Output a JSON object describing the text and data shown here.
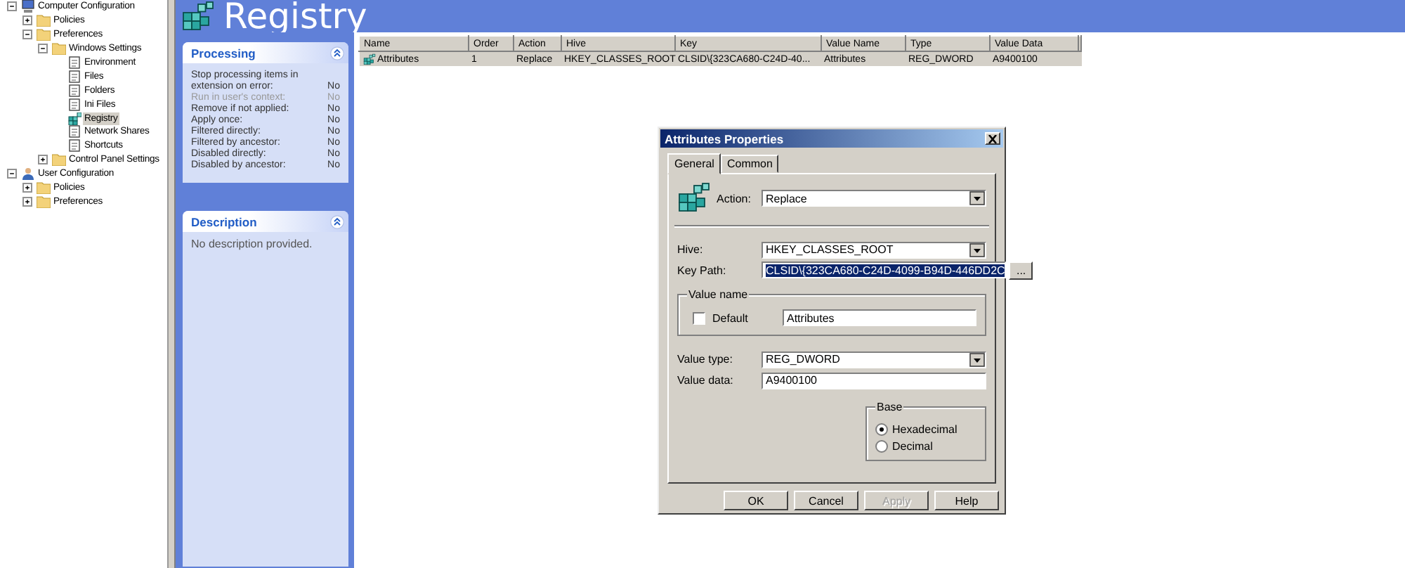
{
  "tree": [
    {
      "label": "Computer Configuration",
      "kind": "computer",
      "expanded": true,
      "selected": false,
      "children": [
        {
          "label": "Policies",
          "kind": "folder",
          "expanded": false,
          "selected": false
        },
        {
          "label": "Preferences",
          "kind": "folder",
          "expanded": true,
          "selected": false,
          "children": [
            {
              "label": "Windows Settings",
              "kind": "folder",
              "expanded": true,
              "selected": false,
              "children": [
                {
                  "label": "Environment",
                  "kind": "item",
                  "selected": false
                },
                {
                  "label": "Files",
                  "kind": "item",
                  "selected": false
                },
                {
                  "label": "Folders",
                  "kind": "item",
                  "selected": false
                },
                {
                  "label": "Ini Files",
                  "kind": "item",
                  "selected": false
                },
                {
                  "label": "Registry",
                  "kind": "registry",
                  "selected": true
                },
                {
                  "label": "Network Shares",
                  "kind": "item",
                  "selected": false
                },
                {
                  "label": "Shortcuts",
                  "kind": "item",
                  "selected": false
                }
              ]
            },
            {
              "label": "Control Panel Settings",
              "kind": "folder",
              "expanded": false,
              "selected": false
            }
          ]
        }
      ]
    },
    {
      "label": "User Configuration",
      "kind": "user",
      "expanded": true,
      "selected": false,
      "children": [
        {
          "label": "Policies",
          "kind": "folder",
          "expanded": false,
          "selected": false
        },
        {
          "label": "Preferences",
          "kind": "folder",
          "expanded": false,
          "selected": false
        }
      ]
    }
  ],
  "header": {
    "title": "Registry"
  },
  "processing": {
    "title": "Processing",
    "rows": [
      {
        "label": "Stop processing items in extension on error:",
        "value": "No",
        "disabled": false
      },
      {
        "label": "Run in user's context:",
        "value": "No",
        "disabled": true
      },
      {
        "label": "Remove if not applied:",
        "value": "No",
        "disabled": false
      },
      {
        "label": "Apply once:",
        "value": "No",
        "disabled": false
      },
      {
        "label": "Filtered directly:",
        "value": "No",
        "disabled": false
      },
      {
        "label": "Filtered by ancestor:",
        "value": "No",
        "disabled": false
      },
      {
        "label": "Disabled directly:",
        "value": "No",
        "disabled": false
      },
      {
        "label": "Disabled by ancestor:",
        "value": "No",
        "disabled": false
      }
    ]
  },
  "description": {
    "title": "Description",
    "text": "No description provided."
  },
  "table": {
    "columns": [
      "Name",
      "Order",
      "Action",
      "Hive",
      "Key",
      "Value Name",
      "Type",
      "Value Data"
    ],
    "rows": [
      {
        "selected": true,
        "cells": [
          "Attributes",
          "1",
          "Replace",
          "HKEY_CLASSES_ROOT",
          "CLSID\\{323CA680-C24D-40...",
          "Attributes",
          "REG_DWORD",
          "A9400100"
        ]
      }
    ]
  },
  "dialog": {
    "title": "Attributes Properties",
    "tabs": [
      {
        "label": "General",
        "selected": true
      },
      {
        "label": "Common",
        "selected": false
      }
    ],
    "action": {
      "label": "Action:",
      "value": "Replace"
    },
    "hive": {
      "label": "Hive:",
      "value": "HKEY_CLASSES_ROOT"
    },
    "key_path": {
      "label": "Key Path:",
      "value": "CLSID\\{323CA680-C24D-4099-B94D-446DD2C",
      "selected": true
    },
    "browse_button": "...",
    "value_name": {
      "title": "Value name",
      "default_checkbox": {
        "label": "Default",
        "checked": false
      },
      "value": "Attributes"
    },
    "value_type": {
      "label": "Value type:",
      "value": "REG_DWORD"
    },
    "value_data": {
      "label": "Value data:",
      "value": "A9400100"
    },
    "base": {
      "title": "Base",
      "options": [
        {
          "label": "Hexadecimal",
          "selected": true
        },
        {
          "label": "Decimal",
          "selected": false
        }
      ]
    },
    "buttons": [
      {
        "label": "OK",
        "disabled": false
      },
      {
        "label": "Cancel",
        "disabled": false
      },
      {
        "label": "Apply",
        "disabled": true
      },
      {
        "label": "Help",
        "disabled": false
      }
    ]
  }
}
